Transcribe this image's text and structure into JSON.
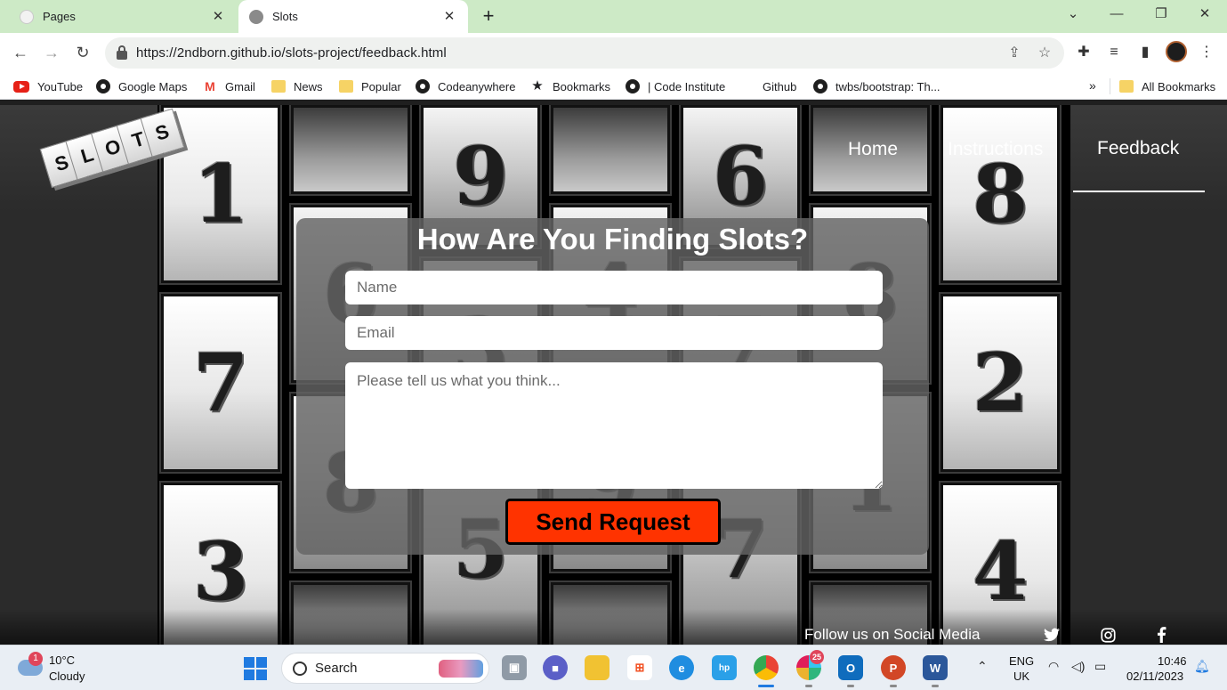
{
  "browser": {
    "tabs": [
      {
        "title": "Pages",
        "active": false
      },
      {
        "title": "Slots",
        "active": true
      }
    ],
    "new_tab_icon": "plus-icon",
    "url": "https://2ndborn.github.io/slots-project/feedback.html",
    "bookmarks": [
      {
        "label": "YouTube",
        "icon": "youtube-icon"
      },
      {
        "label": "Google Maps",
        "icon": "globe-icon"
      },
      {
        "label": "Gmail",
        "icon": "gmail-icon"
      },
      {
        "label": "News",
        "icon": "folder-icon"
      },
      {
        "label": "Popular",
        "icon": "folder-icon"
      },
      {
        "label": "Codeanywhere",
        "icon": "globe-icon"
      },
      {
        "label": "Bookmarks",
        "icon": "star-icon"
      },
      {
        "label": "| Code Institute",
        "icon": "globe-icon"
      },
      {
        "label": "Github",
        "icon": "none"
      },
      {
        "label": "twbs/bootstrap: Th...",
        "icon": "globe-icon"
      }
    ],
    "more_bookmarks": "»",
    "all_bookmarks": "All Bookmarks"
  },
  "site": {
    "logo_letters": [
      "S",
      "L",
      "O",
      "T",
      "S"
    ],
    "nav": [
      {
        "label": "Home",
        "active": false
      },
      {
        "label": "Instructions",
        "active": false
      },
      {
        "label": "Feedback",
        "active": true
      }
    ],
    "background_digits": {
      "col1": [
        "1",
        "7",
        "3"
      ],
      "col2": [
        "6",
        "8"
      ],
      "col3": [
        "9",
        "3",
        "5"
      ],
      "col4": [
        "4",
        "9"
      ],
      "col5": [
        "6",
        "7",
        "7"
      ],
      "col6": [
        "8",
        "1"
      ],
      "col7": [
        "8",
        "2",
        "4"
      ]
    },
    "form": {
      "title": "How Are You Finding Slots?",
      "name_placeholder": "Name",
      "email_placeholder": "Email",
      "message_placeholder": "Please tell us what you think...",
      "submit_label": "Send Request"
    },
    "footer": {
      "text": "Follow us on Social Media",
      "icons": [
        "twitter-icon",
        "instagram-icon",
        "facebook-icon"
      ]
    },
    "colors": {
      "accent": "#ff3300",
      "background": "#2b2b2b",
      "text": "#ffffff"
    }
  },
  "taskbar": {
    "weather_temp": "10°C",
    "weather_cond": "Cloudy",
    "weather_badge": "1",
    "search_label": "Search",
    "slack_badge": "25",
    "lang_line1": "ENG",
    "lang_line2": "UK",
    "time": "10:46",
    "date": "02/11/2023"
  }
}
